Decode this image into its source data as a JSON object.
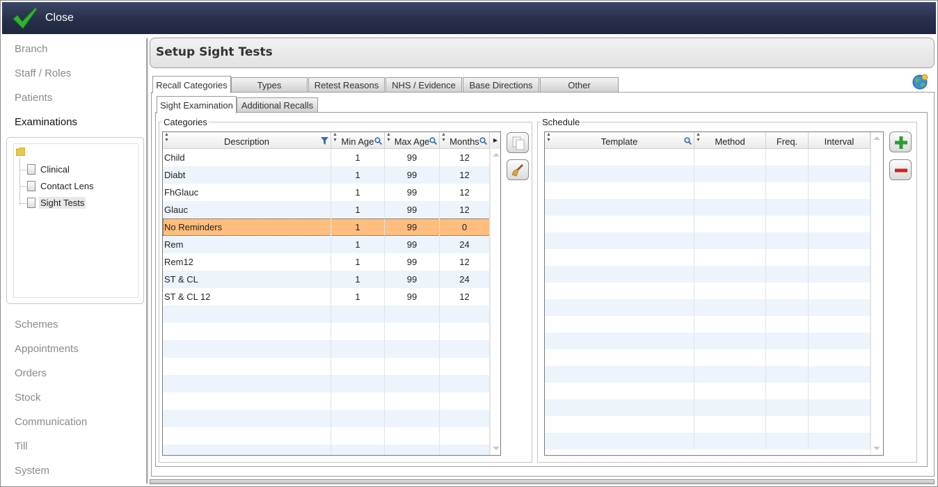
{
  "titlebar": {
    "close_label": "Close"
  },
  "sidebar": {
    "items_top": [
      {
        "label": "Branch"
      },
      {
        "label": "Staff / Roles"
      },
      {
        "label": "Patients"
      },
      {
        "label": "Examinations",
        "active": true
      }
    ],
    "tree": [
      {
        "label": "Clinical"
      },
      {
        "label": "Contact Lens"
      },
      {
        "label": "Sight Tests",
        "selected": true
      }
    ],
    "items_bottom": [
      {
        "label": "Schemes"
      },
      {
        "label": "Appointments"
      },
      {
        "label": "Orders"
      },
      {
        "label": "Stock"
      },
      {
        "label": "Communication"
      },
      {
        "label": "Till"
      },
      {
        "label": "System"
      }
    ]
  },
  "header": {
    "title": "Setup Sight Tests"
  },
  "tabs": [
    {
      "label": "Recall Categories",
      "active": true
    },
    {
      "label": "Types"
    },
    {
      "label": "Retest Reasons"
    },
    {
      "label": "NHS / Evidence"
    },
    {
      "label": "Base Directions"
    },
    {
      "label": "Other"
    }
  ],
  "subtabs": [
    {
      "label": "Sight Examination",
      "active": true
    },
    {
      "label": "Additional Recalls"
    }
  ],
  "categories": {
    "legend": "Categories",
    "columns": [
      "Description",
      "Min Age",
      "Max Age",
      "Months"
    ],
    "rows": [
      {
        "description": "Child",
        "min_age": "1",
        "max_age": "99",
        "months": "12"
      },
      {
        "description": "Diabt",
        "min_age": "1",
        "max_age": "99",
        "months": "12"
      },
      {
        "description": "FhGlauc",
        "min_age": "1",
        "max_age": "99",
        "months": "12"
      },
      {
        "description": "Glauc",
        "min_age": "1",
        "max_age": "99",
        "months": "12"
      },
      {
        "description": "No Reminders",
        "min_age": "1",
        "max_age": "99",
        "months": "0",
        "selected": true
      },
      {
        "description": "Rem",
        "min_age": "1",
        "max_age": "99",
        "months": "24"
      },
      {
        "description": "Rem12",
        "min_age": "1",
        "max_age": "99",
        "months": "12"
      },
      {
        "description": "ST & CL",
        "min_age": "1",
        "max_age": "99",
        "months": "24"
      },
      {
        "description": "ST & CL 12",
        "min_age": "1",
        "max_age": "99",
        "months": "12"
      }
    ],
    "empty_rows": 9
  },
  "schedule": {
    "legend": "Schedule",
    "columns": [
      "Template",
      "Method",
      "Freq.",
      "Interval"
    ],
    "empty_rows": 18
  },
  "colors": {
    "titlebar": "#27304a",
    "selected_row": "#ffbe7d",
    "alt_row": "#edf4fb",
    "add_icon": "#2e9b2e",
    "remove_icon": "#d42020"
  },
  "icons": {
    "close": "checkmark-icon",
    "globe": "globe-icon",
    "copy": "copy-icon",
    "clear": "broom-icon",
    "add": "plus-icon",
    "remove": "minus-icon",
    "filter": "filter-icon",
    "search": "search-icon"
  }
}
